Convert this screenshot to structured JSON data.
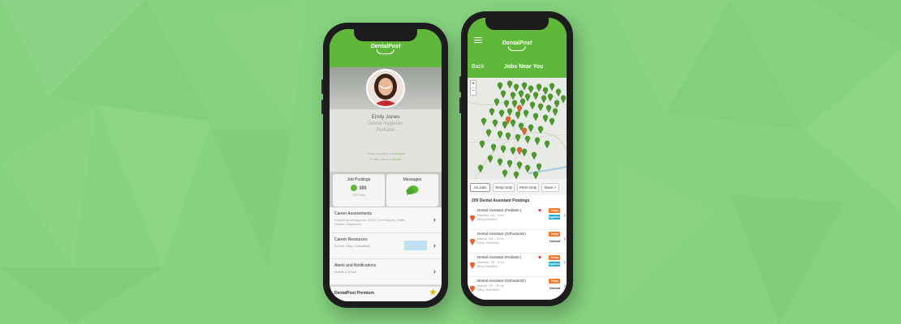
{
  "colors": {
    "background": "#86d27f",
    "brand_green": "#5fb83a",
    "pin_green": "#4d9a2c",
    "pin_orange": "#e8622b",
    "tag_temp": "#ef7a2b",
    "tag_applied": "#22a8d6",
    "heart": "#d8262a"
  },
  "brand": {
    "logo_text": "DentalPost"
  },
  "left_phone": {
    "profile": {
      "name": "Emily Jones",
      "title": "Dental Hygienist",
      "specialty": "Pediatric",
      "visibility_line1_prefix": "Profile visibility is ",
      "visibility_line1_value": "Enabled",
      "visibility_line2_prefix": "Profile status is ",
      "visibility_line2_value": "Public"
    },
    "cards": {
      "jobs": {
        "title": "Job Postings",
        "count": "101",
        "sub": "(100 new)"
      },
      "messages": {
        "title": "Messages",
        "icon": "chat-bubble-icon"
      }
    },
    "menu_items": [
      {
        "title": "Career Assessments",
        "sub": "Emotional Intelligence, DISC, Core Values, Skills, Culture, Alignment"
      },
      {
        "title": "Career Resources",
        "sub": "Events, Blog, Classifieds"
      },
      {
        "title": "Alerts and Notifications",
        "sub": "Mobile & Email"
      }
    ],
    "premium": {
      "label": "DentalPost Premium",
      "icon": "star-icon"
    }
  },
  "right_phone": {
    "nav": {
      "back": "Back",
      "title": "Jobs Near You"
    },
    "zoom": {
      "plus": "+",
      "minus": "−"
    },
    "filters": [
      "All Jobs",
      "Temp Only",
      "Perm Only",
      "More >"
    ],
    "postings_heading": "209 Dental Assistant Postings",
    "jobs": [
      {
        "title": "Dental Assistant (Pediatric)",
        "location": "Marietta, GA – 8 mi.",
        "office": "Bling Dentistry",
        "favorite": true,
        "tags": [
          "Temp",
          "Applied"
        ],
        "status": ""
      },
      {
        "title": "Dental Assistant (Orthodontic)",
        "location": "Atlanta, GA – 16 mi.",
        "office": "Killey TestOffice",
        "favorite": false,
        "tags": [
          "Temp"
        ],
        "status": "Unread"
      },
      {
        "title": "Dental Assistant (Pediatric)",
        "location": "Marietta, GA – 8 mi.",
        "office": "Bling Dentistry",
        "favorite": true,
        "tags": [
          "Temp",
          "Applied"
        ],
        "status": ""
      },
      {
        "title": "Dental Assistant (Orthodontic)",
        "location": "Atlanta, GA – 16 mi.",
        "office": "Killey TestOffice",
        "favorite": false,
        "tags": [
          "Temp"
        ],
        "status": "Unread"
      }
    ]
  }
}
